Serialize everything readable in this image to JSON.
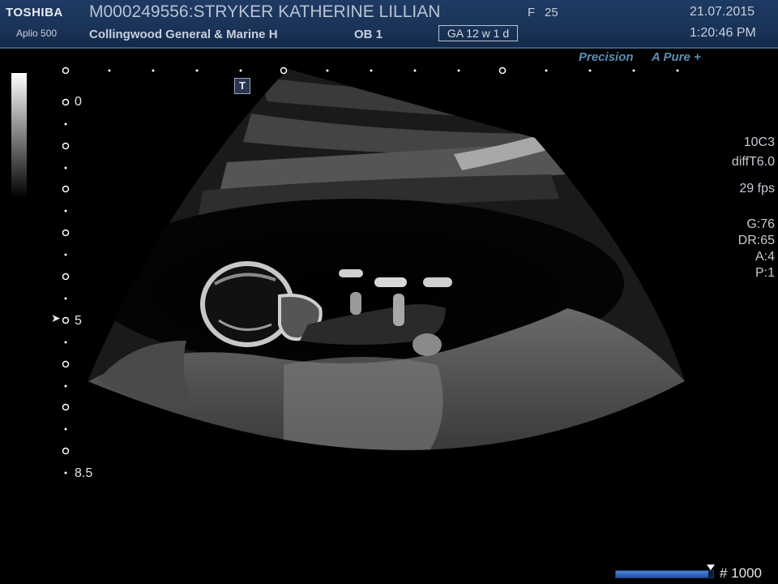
{
  "header": {
    "logo": "TOSHIBA",
    "model": "Aplio 500",
    "patient": "M000249556:STRYKER KATHERINE LILLIAN",
    "sex": "F",
    "age": "25",
    "hospital": "Collingwood General & Marine H",
    "exam": "OB 1",
    "ga": "GA  12 w 1 d",
    "date": "21.07.2015",
    "time": "1:20:46 PM"
  },
  "imaging": {
    "brand_precision": "Precision",
    "brand_apure": "A Pure +",
    "probe": "10C3",
    "mode": "diffT6.0",
    "fps": "29 fps",
    "gain": "G:76",
    "dynamic_range": "DR:65",
    "a": "A:4",
    "p": "P:1",
    "t_marker": "T"
  },
  "depth_scale": {
    "labels": [
      "0",
      "5",
      "8.5"
    ],
    "focus_marker": "➤"
  },
  "cine": {
    "progress": 0.95,
    "frame_label": "# 1000"
  },
  "colors": {
    "header_bg": "#1b3559",
    "brand_text": "#5b90b4",
    "progress_fill": "#2f62c0"
  }
}
